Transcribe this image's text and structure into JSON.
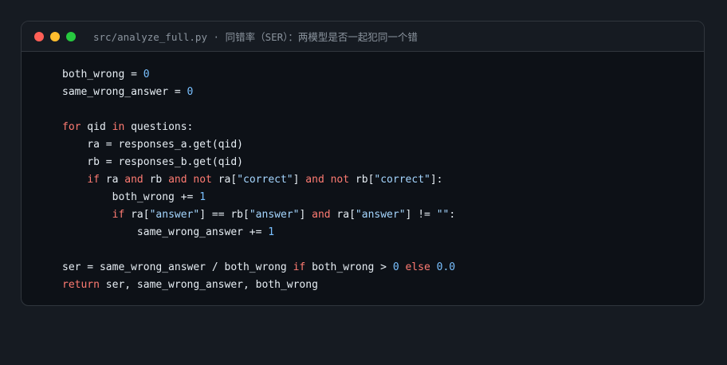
{
  "window": {
    "title": "src/analyze_full.py · 同错率（SER）：两模型是否一起犯同一个错",
    "controls": [
      {
        "name": "close",
        "color": "#ff5f56"
      },
      {
        "name": "minimize",
        "color": "#ffbd2e"
      },
      {
        "name": "maximize",
        "color": "#27c93f"
      }
    ]
  },
  "colors": {
    "background": "#161b22",
    "editor": "#0d1117",
    "text": "#e6edf3",
    "keyword": "#ff7b72",
    "number": "#79c0ff",
    "string": "#a5d6ff"
  },
  "code": {
    "language": "python",
    "lines": [
      [
        {
          "t": "both_wrong = "
        },
        {
          "t": "0",
          "c": "num"
        }
      ],
      [
        {
          "t": "same_wrong_answer = "
        },
        {
          "t": "0",
          "c": "num"
        }
      ],
      [],
      [
        {
          "t": "for",
          "c": "kw"
        },
        {
          "t": " qid "
        },
        {
          "t": "in",
          "c": "kw"
        },
        {
          "t": " questions:"
        }
      ],
      [
        {
          "t": "    ra = responses_a.get(qid)"
        }
      ],
      [
        {
          "t": "    rb = responses_b.get(qid)"
        }
      ],
      [
        {
          "t": "    "
        },
        {
          "t": "if",
          "c": "kw"
        },
        {
          "t": " ra "
        },
        {
          "t": "and",
          "c": "kw"
        },
        {
          "t": " rb "
        },
        {
          "t": "and",
          "c": "kw"
        },
        {
          "t": " "
        },
        {
          "t": "not",
          "c": "kw"
        },
        {
          "t": " ra["
        },
        {
          "t": "\"correct\"",
          "c": "str"
        },
        {
          "t": "] "
        },
        {
          "t": "and",
          "c": "kw"
        },
        {
          "t": " "
        },
        {
          "t": "not",
          "c": "kw"
        },
        {
          "t": " rb["
        },
        {
          "t": "\"correct\"",
          "c": "str"
        },
        {
          "t": "]:"
        }
      ],
      [
        {
          "t": "        both_wrong += "
        },
        {
          "t": "1",
          "c": "num"
        }
      ],
      [
        {
          "t": "        "
        },
        {
          "t": "if",
          "c": "kw"
        },
        {
          "t": " ra["
        },
        {
          "t": "\"answer\"",
          "c": "str"
        },
        {
          "t": "] == rb["
        },
        {
          "t": "\"answer\"",
          "c": "str"
        },
        {
          "t": "] "
        },
        {
          "t": "and",
          "c": "kw"
        },
        {
          "t": " ra["
        },
        {
          "t": "\"answer\"",
          "c": "str"
        },
        {
          "t": "] != "
        },
        {
          "t": "\"\"",
          "c": "str"
        },
        {
          "t": ":"
        }
      ],
      [
        {
          "t": "            same_wrong_answer += "
        },
        {
          "t": "1",
          "c": "num"
        }
      ],
      [],
      [
        {
          "t": "ser = same_wrong_answer / both_wrong "
        },
        {
          "t": "if",
          "c": "kw"
        },
        {
          "t": " both_wrong > "
        },
        {
          "t": "0",
          "c": "num"
        },
        {
          "t": " "
        },
        {
          "t": "else",
          "c": "kw"
        },
        {
          "t": " "
        },
        {
          "t": "0.0",
          "c": "num"
        }
      ],
      [
        {
          "t": "return",
          "c": "kw"
        },
        {
          "t": " ser, same_wrong_answer, both_wrong"
        }
      ]
    ]
  }
}
